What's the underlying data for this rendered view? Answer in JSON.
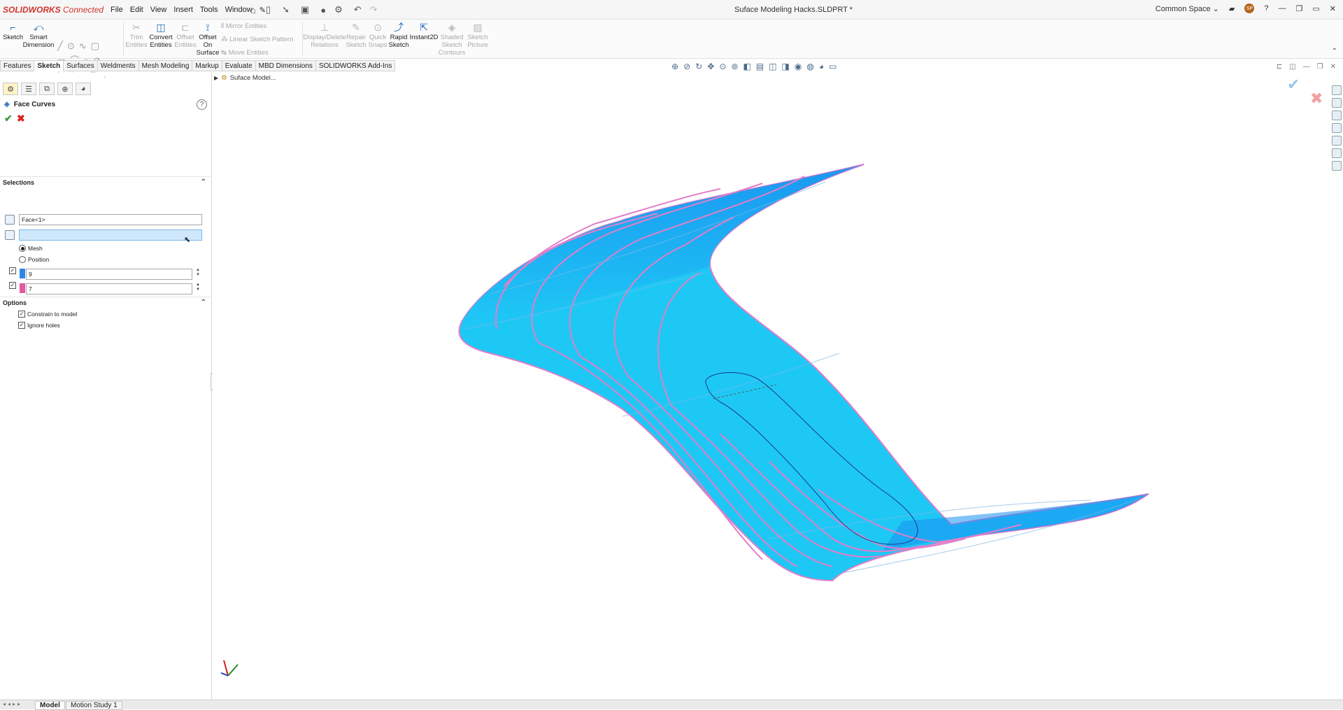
{
  "app": {
    "logo_text": "SOLIDWORKS",
    "logo_suffix": "Connected",
    "document_title": "Suface Modeling Hacks.SLDPRT *",
    "workspace": "Common Space",
    "user_initials": "SP"
  },
  "menu": [
    "File",
    "Edit",
    "View",
    "Insert",
    "Tools",
    "Window"
  ],
  "ribbon": {
    "sketch": "Sketch",
    "smart_dimension": "Smart Dimension",
    "trim_entities": "Trim Entities",
    "convert_entities": "Convert Entities",
    "offset_entities": "Offset Entities",
    "offset_on_surface": "Offset On Surface",
    "mirror_entities": "Mirror Entities",
    "linear_sketch_pattern": "Linear Sketch Pattern",
    "move_entities": "Move Entities",
    "display_delete_relations": "Display/Delete Relations",
    "repair_sketch": "Repair Sketch",
    "quick_snaps": "Quick Snaps",
    "rapid_sketch": "Rapid Sketch",
    "instant2d": "Instant2D",
    "shaded_sketch_contours": "Shaded Sketch Contours",
    "sketch_picture": "Sketch Picture"
  },
  "tabs": [
    "Features",
    "Sketch",
    "Surfaces",
    "Weldments",
    "Mesh Modeling",
    "Markup",
    "Evaluate",
    "MBD Dimensions",
    "SOLIDWORKS Add-Ins"
  ],
  "active_tab": "Sketch",
  "property_manager": {
    "title": "Face Curves",
    "selections_header": "Selections",
    "face_value": "Face<1>",
    "vertex_value": "",
    "mode_mesh": "Mesh",
    "mode_position": "Position",
    "mode_selected": "Mesh",
    "dir1_value": "9",
    "dir2_value": "7",
    "dir1_color": "#2f86e6",
    "dir2_color": "#e25aa0",
    "options_header": "Options",
    "constrain_to_model": "Constrain to model",
    "ignore_holes": "Ignore holes"
  },
  "graphics": {
    "tree_item": "Suface Model...",
    "surface_color": "#1ec8f5",
    "surface_top_color": "#1a8ff0",
    "curve_color": "#e07ec8"
  },
  "bottom_tabs": [
    "Model",
    "Motion Study 1"
  ]
}
